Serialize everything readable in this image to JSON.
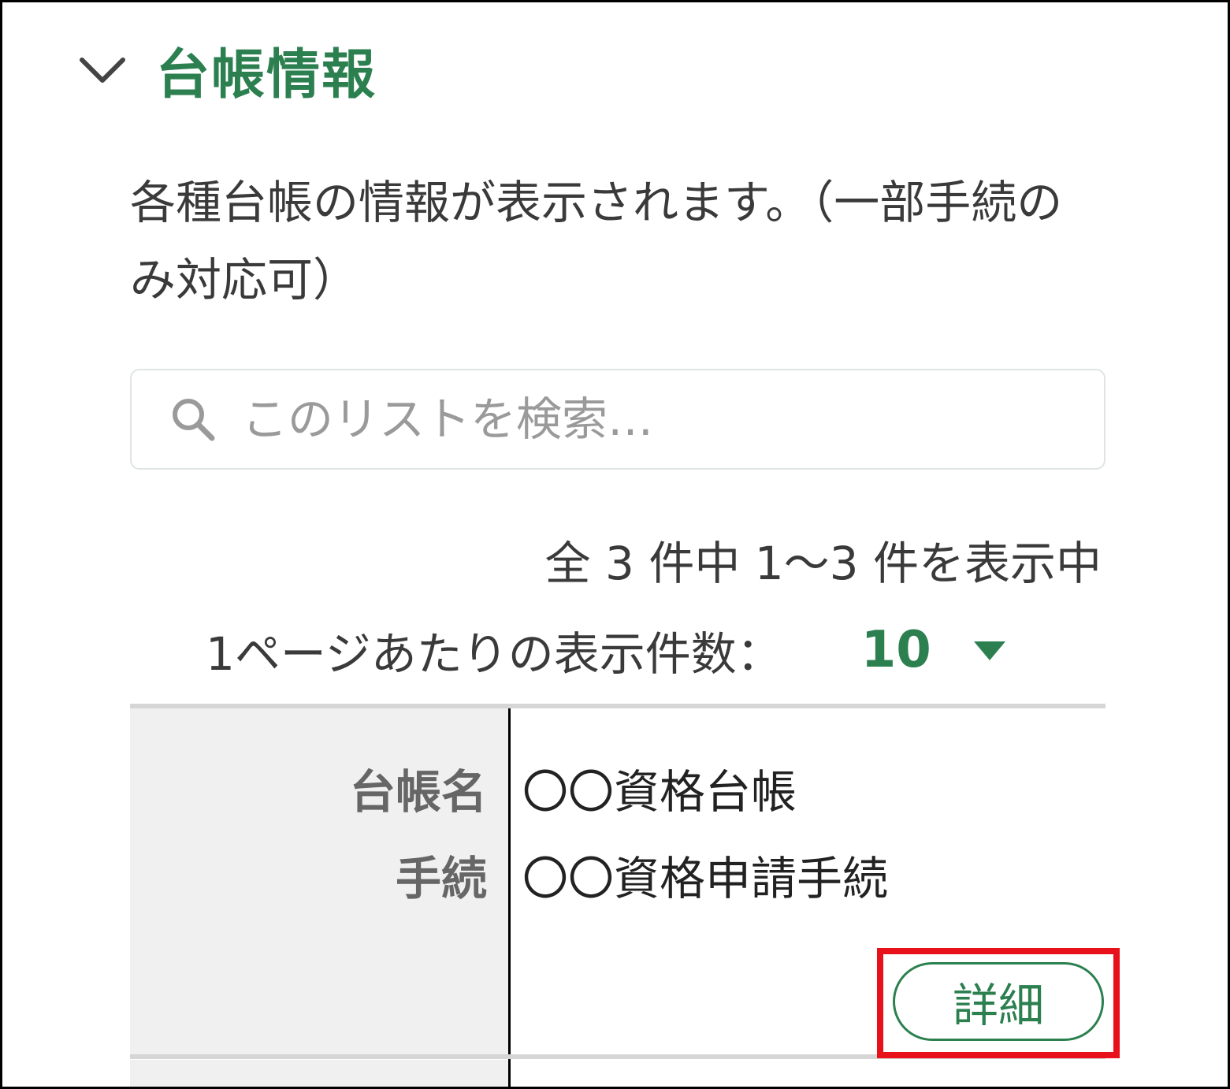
{
  "section": {
    "title": "台帳情報",
    "toggle_icon": "chevron-down-icon",
    "description": "各種台帳の情報が表示されます。（一部手続のみ対応可）"
  },
  "search": {
    "icon": "search-icon",
    "placeholder": "このリストを検索…",
    "value": ""
  },
  "pagination": {
    "result_text": "全 3 件中 1～3 件を表示中",
    "per_page_label": "1ページあたりの表示件数：",
    "per_page_value": "10",
    "per_page_icon": "caret-down-icon"
  },
  "records": [
    {
      "fields": [
        {
          "label": "台帳名",
          "value": "〇〇資格台帳"
        },
        {
          "label": "手続",
          "value": "〇〇資格申請手続"
        }
      ],
      "detail_label": "詳細"
    }
  ],
  "colors": {
    "accent": "#2c8050",
    "highlight": "#e8101a",
    "label_bg": "#f0f0f0"
  }
}
